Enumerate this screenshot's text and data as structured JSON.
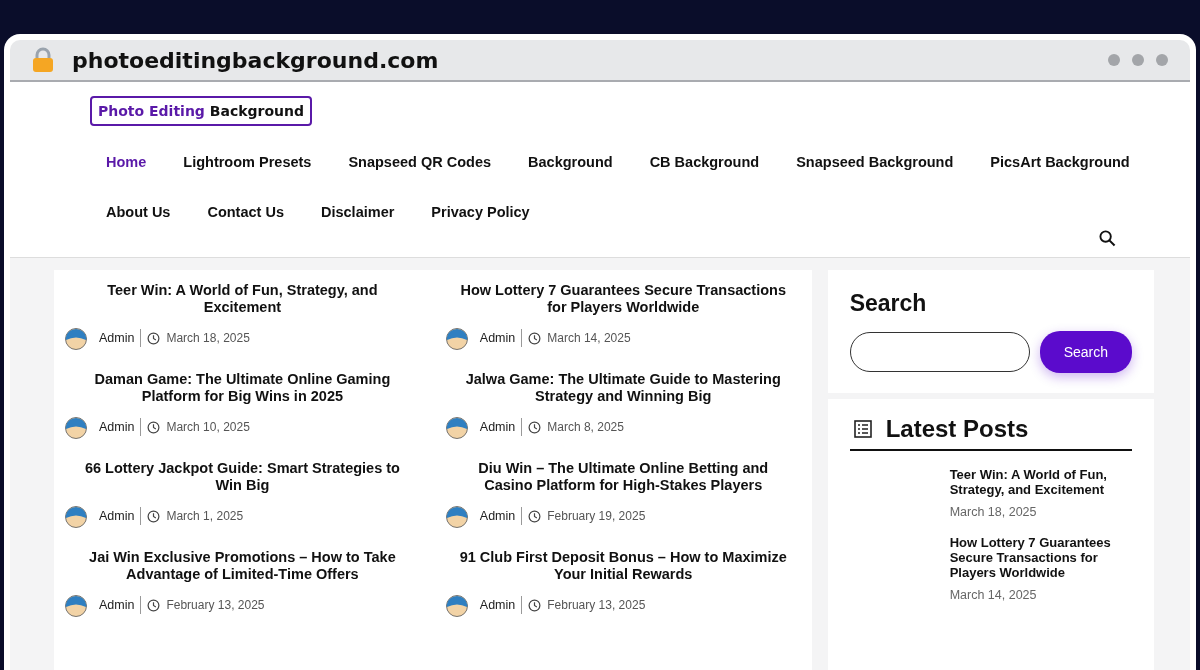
{
  "browser": {
    "address": "photoeditingbackground.com"
  },
  "logo": {
    "first": "Photo Editing",
    "second": "Background"
  },
  "nav": [
    {
      "label": "Home",
      "selected": true
    },
    {
      "label": "Lightroom Presets",
      "selected": false
    },
    {
      "label": "Snapseed QR Codes",
      "selected": false
    },
    {
      "label": "Background",
      "selected": false
    },
    {
      "label": "CB Background",
      "selected": false
    },
    {
      "label": "Snapseed Background",
      "selected": false
    },
    {
      "label": "PicsArt Background",
      "selected": false
    },
    {
      "label": "About Us",
      "selected": false
    },
    {
      "label": "Contact Us",
      "selected": false
    },
    {
      "label": "Disclaimer",
      "selected": false
    },
    {
      "label": "Privacy Policy",
      "selected": false
    }
  ],
  "posts": [
    {
      "title": "Teer Win: A World of Fun, Strategy, and Excitement",
      "author": "Admin",
      "date": "March 18, 2025"
    },
    {
      "title": "How Lottery 7 Guarantees Secure Transactions for Players Worldwide",
      "author": "Admin",
      "date": "March 14, 2025"
    },
    {
      "title": "Daman Game: The Ultimate Online Gaming Platform for Big Wins in 2025",
      "author": "Admin",
      "date": "March 10, 2025"
    },
    {
      "title": "Jalwa Game: The Ultimate Guide to Mastering Strategy and Winning Big",
      "author": "Admin",
      "date": "March 8, 2025"
    },
    {
      "title": "66 Lottery Jackpot Guide: Smart Strategies to Win Big",
      "author": "Admin",
      "date": "March 1, 2025"
    },
    {
      "title": "Diu Win – The Ultimate Online Betting and Casino Platform for High-Stakes Players",
      "author": "Admin",
      "date": "February 19, 2025"
    },
    {
      "title": "Jai Win Exclusive Promotions – How to Take Advantage of Limited-Time Offers",
      "author": "Admin",
      "date": "February 13, 2025"
    },
    {
      "title": "91 Club First Deposit Bonus – How to Maximize Your Initial Rewards",
      "author": "Admin",
      "date": "February 13, 2025"
    }
  ],
  "sidebar": {
    "search": {
      "title": "Search",
      "button": "Search"
    },
    "latest": {
      "title": "Latest Posts",
      "items": [
        {
          "title": "Teer Win: A World of Fun, Strategy, and Excitement",
          "date": "March 18, 2025"
        },
        {
          "title": "How Lottery 7 Guarantees Secure Transactions for Players Worldwide",
          "date": "March 14, 2025"
        }
      ]
    }
  }
}
